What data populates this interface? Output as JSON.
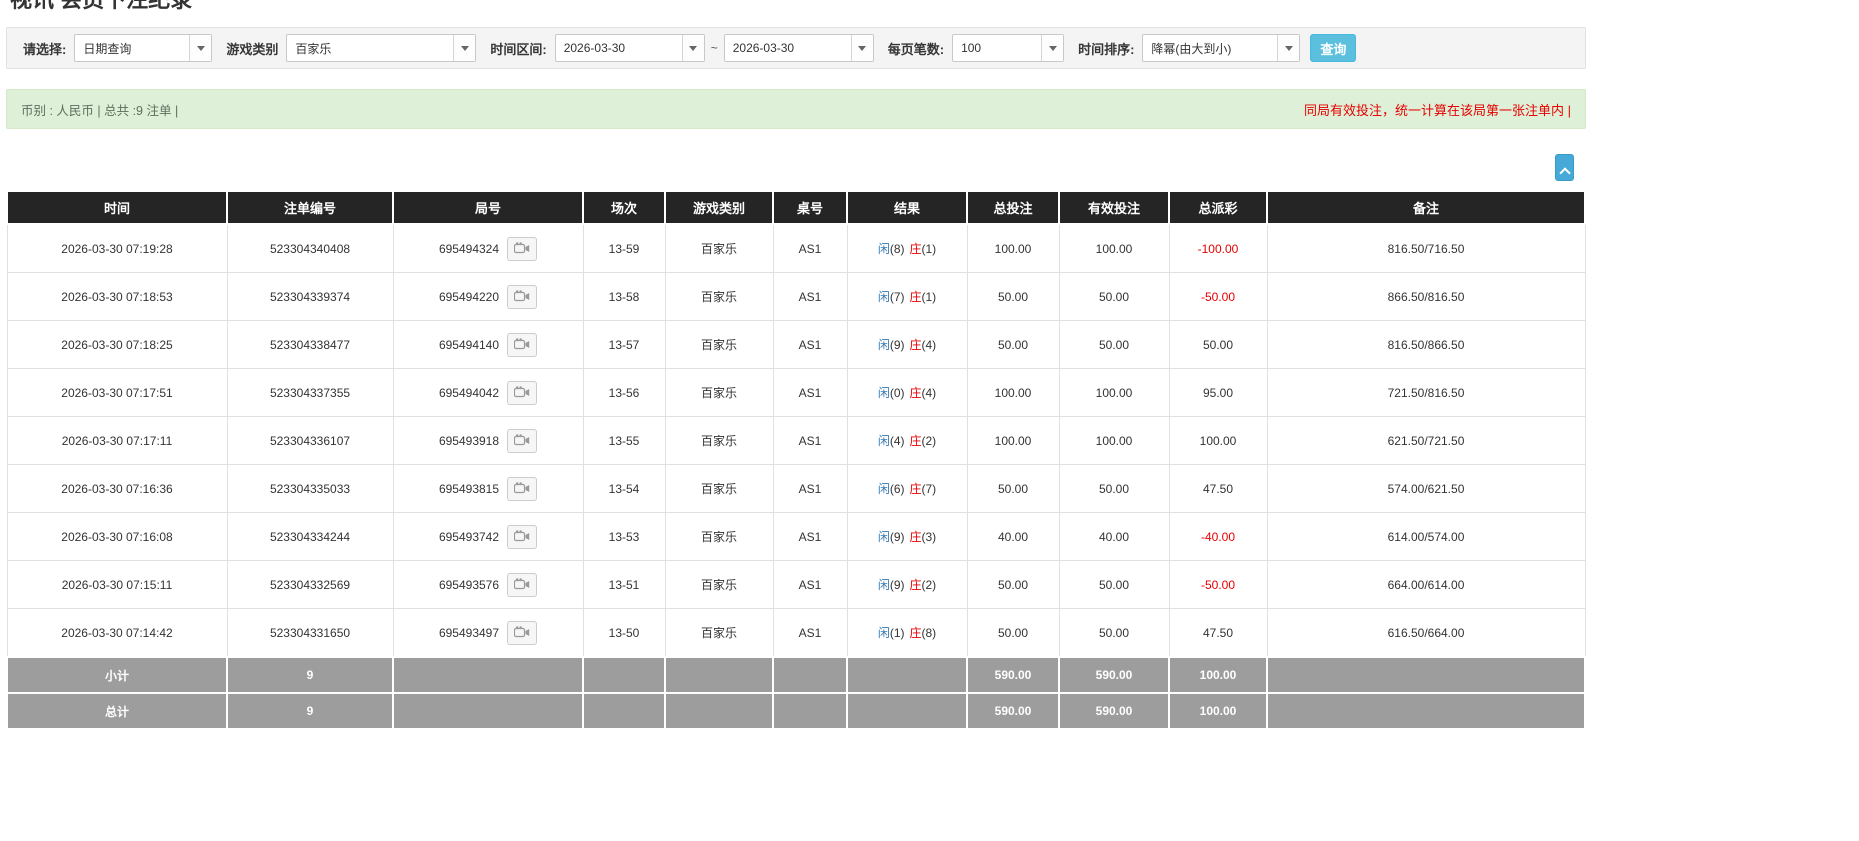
{
  "page": {
    "title": "视讯 会员下注纪录"
  },
  "filter": {
    "select_label": "请选择:",
    "select_value": "日期查询",
    "game_label": "游戏类别",
    "game_value": "百家乐",
    "range_label": "时间区间:",
    "date_from": "2026-03-30",
    "range_separator": "~",
    "date_to": "2026-03-30",
    "page_size_label": "每页笔数:",
    "page_size_value": "100",
    "sort_label": "时间排序:",
    "sort_value": "降幂(由大到小)",
    "search_button_label": "查询"
  },
  "summary": {
    "currency_info": "币别 : 人民币 | 总共 :9 注单 |",
    "notice": "同局有效投注，统一计算在该局第一张注单内 |"
  },
  "table": {
    "headers": [
      "时间",
      "注单编号",
      "局号",
      "场次",
      "游戏类别",
      "桌号",
      "结果",
      "总投注",
      "有效投注",
      "总派彩",
      "备注"
    ],
    "rows": [
      {
        "time": "2026-03-30 07:19:28",
        "bet_no": "523304340408",
        "round_no": "695494324",
        "session": "13-59",
        "game": "百家乐",
        "table_no": "AS1",
        "player": "闲",
        "player_score": "(8)",
        "banker": "庄",
        "banker_score": "(1)",
        "total_bet": "100.00",
        "valid_bet": "100.00",
        "payout": "-100.00",
        "note": "816.50/716.50"
      },
      {
        "time": "2026-03-30 07:18:53",
        "bet_no": "523304339374",
        "round_no": "695494220",
        "session": "13-58",
        "game": "百家乐",
        "table_no": "AS1",
        "player": "闲",
        "player_score": "(7)",
        "banker": "庄",
        "banker_score": "(1)",
        "total_bet": "50.00",
        "valid_bet": "50.00",
        "payout": "-50.00",
        "note": "866.50/816.50"
      },
      {
        "time": "2026-03-30 07:18:25",
        "bet_no": "523304338477",
        "round_no": "695494140",
        "session": "13-57",
        "game": "百家乐",
        "table_no": "AS1",
        "player": "闲",
        "player_score": "(9)",
        "banker": "庄",
        "banker_score": "(4)",
        "total_bet": "50.00",
        "valid_bet": "50.00",
        "payout": "50.00",
        "note": "816.50/866.50"
      },
      {
        "time": "2026-03-30 07:17:51",
        "bet_no": "523304337355",
        "round_no": "695494042",
        "session": "13-56",
        "game": "百家乐",
        "table_no": "AS1",
        "player": "闲",
        "player_score": "(0)",
        "banker": "庄",
        "banker_score": "(4)",
        "total_bet": "100.00",
        "valid_bet": "100.00",
        "payout": "95.00",
        "note": "721.50/816.50"
      },
      {
        "time": "2026-03-30 07:17:11",
        "bet_no": "523304336107",
        "round_no": "695493918",
        "session": "13-55",
        "game": "百家乐",
        "table_no": "AS1",
        "player": "闲",
        "player_score": "(4)",
        "banker": "庄",
        "banker_score": "(2)",
        "total_bet": "100.00",
        "valid_bet": "100.00",
        "payout": "100.00",
        "note": "621.50/721.50"
      },
      {
        "time": "2026-03-30 07:16:36",
        "bet_no": "523304335033",
        "round_no": "695493815",
        "session": "13-54",
        "game": "百家乐",
        "table_no": "AS1",
        "player": "闲",
        "player_score": "(6)",
        "banker": "庄",
        "banker_score": "(7)",
        "total_bet": "50.00",
        "valid_bet": "50.00",
        "payout": "47.50",
        "note": "574.00/621.50"
      },
      {
        "time": "2026-03-30 07:16:08",
        "bet_no": "523304334244",
        "round_no": "695493742",
        "session": "13-53",
        "game": "百家乐",
        "table_no": "AS1",
        "player": "闲",
        "player_score": "(9)",
        "banker": "庄",
        "banker_score": "(3)",
        "total_bet": "40.00",
        "valid_bet": "40.00",
        "payout": "-40.00",
        "note": "614.00/574.00"
      },
      {
        "time": "2026-03-30 07:15:11",
        "bet_no": "523304332569",
        "round_no": "695493576",
        "session": "13-51",
        "game": "百家乐",
        "table_no": "AS1",
        "player": "闲",
        "player_score": "(9)",
        "banker": "庄",
        "banker_score": "(2)",
        "total_bet": "50.00",
        "valid_bet": "50.00",
        "payout": "-50.00",
        "note": "664.00/614.00"
      },
      {
        "time": "2026-03-30 07:14:42",
        "bet_no": "523304331650",
        "round_no": "695493497",
        "session": "13-50",
        "game": "百家乐",
        "table_no": "AS1",
        "player": "闲",
        "player_score": "(1)",
        "banker": "庄",
        "banker_score": "(8)",
        "total_bet": "50.00",
        "valid_bet": "50.00",
        "payout": "47.50",
        "note": "616.50/664.00"
      }
    ],
    "subtotal": {
      "label": "小计",
      "count": "9",
      "total_bet": "590.00",
      "valid_bet": "590.00",
      "payout": "100.00"
    },
    "grand_total": {
      "label": "总计",
      "count": "9",
      "total_bet": "590.00",
      "valid_bet": "590.00",
      "payout": "100.00"
    }
  },
  "colors": {
    "accent_blue": "#337ab7",
    "negative_red": "#e60000",
    "search_button_blue": "#5bc0de",
    "table_header_bg": "#252525",
    "table_footer_bg": "#9d9d9d",
    "summary_bg": "#dff0d8"
  }
}
